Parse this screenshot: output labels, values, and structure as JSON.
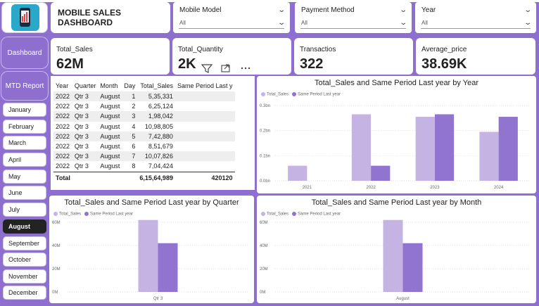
{
  "title": "MOBILE SALES DASHBOARD",
  "slicers": [
    {
      "label": "Mobile Model",
      "value": "All"
    },
    {
      "label": "Payment Method",
      "value": "All"
    },
    {
      "label": "Year",
      "value": "All"
    }
  ],
  "nav": {
    "dashboard": "Dashboard",
    "mtd": "MTD Report"
  },
  "months": [
    "January",
    "February",
    "March",
    "April",
    "May",
    "June",
    "July",
    "August",
    "September",
    "October",
    "November",
    "December"
  ],
  "selected_month": "August",
  "kpis": [
    {
      "label": "Total_Sales",
      "value": "62M"
    },
    {
      "label": "Total_Quantity",
      "value": "2K"
    },
    {
      "label": "Transactios",
      "value": "322"
    },
    {
      "label": "Average_price",
      "value": "38.69K"
    }
  ],
  "table": {
    "headers": [
      "Year",
      "Quarter",
      "Month",
      "Day",
      "Total_Sales",
      "Same Period Last y"
    ],
    "rows": [
      [
        "2022",
        "Qtr 3",
        "August",
        "1",
        "5,35,331",
        ""
      ],
      [
        "2022",
        "Qtr 3",
        "August",
        "2",
        "6,25,124",
        ""
      ],
      [
        "2022",
        "Qtr 3",
        "August",
        "3",
        "1,98,042",
        ""
      ],
      [
        "2022",
        "Qtr 3",
        "August",
        "4",
        "10,98,805",
        ""
      ],
      [
        "2022",
        "Qtr 3",
        "August",
        "5",
        "7,42,880",
        ""
      ],
      [
        "2022",
        "Qtr 3",
        "August",
        "6",
        "8,51,679",
        ""
      ],
      [
        "2022",
        "Qtr 3",
        "August",
        "7",
        "10,07,826",
        ""
      ],
      [
        "2022",
        "Qtr 3",
        "August",
        "8",
        "7,04,424",
        ""
      ]
    ],
    "total_label": "Total",
    "total_sales": "6,15,64,989",
    "total_last": "420120"
  },
  "legend": {
    "a": "Total_Sales",
    "b": "Same Period Last year"
  },
  "colors": {
    "total_sales": "#c5b4e3",
    "last_year": "#9173d0",
    "frame": "#8e6fcf"
  },
  "chart_data": [
    {
      "type": "bar",
      "title": "Total_Sales and Same Period Last year by Year",
      "categories": [
        "2021",
        "2022",
        "2023",
        "2024"
      ],
      "series": [
        {
          "name": "Total_Sales",
          "values": [
            0.06,
            0.265,
            0.255,
            0.195
          ]
        },
        {
          "name": "Same Period Last year",
          "values": [
            0,
            0.06,
            0.265,
            0.255
          ]
        }
      ],
      "yticks": [
        "0.0bn",
        "0.1bn",
        "0.2bn",
        "0.3bn"
      ],
      "ylim": [
        0,
        0.3
      ]
    },
    {
      "type": "bar",
      "title": "Total_Sales and Same Period Last year by Quarter",
      "categories": [
        "Qtr 3"
      ],
      "series": [
        {
          "name": "Total_Sales",
          "values": [
            62
          ]
        },
        {
          "name": "Same Period Last year",
          "values": [
            42
          ]
        }
      ],
      "yticks": [
        "0M",
        "20M",
        "40M",
        "60M"
      ],
      "ylim": [
        0,
        60
      ]
    },
    {
      "type": "bar",
      "title": "Total_Sales and Same Period Last year by Month",
      "categories": [
        "August"
      ],
      "series": [
        {
          "name": "Total_Sales",
          "values": [
            62
          ]
        },
        {
          "name": "Same Period Last year",
          "values": [
            42
          ]
        }
      ],
      "yticks": [
        "0M",
        "20M",
        "40M",
        "60M"
      ],
      "ylim": [
        0,
        60
      ]
    }
  ]
}
